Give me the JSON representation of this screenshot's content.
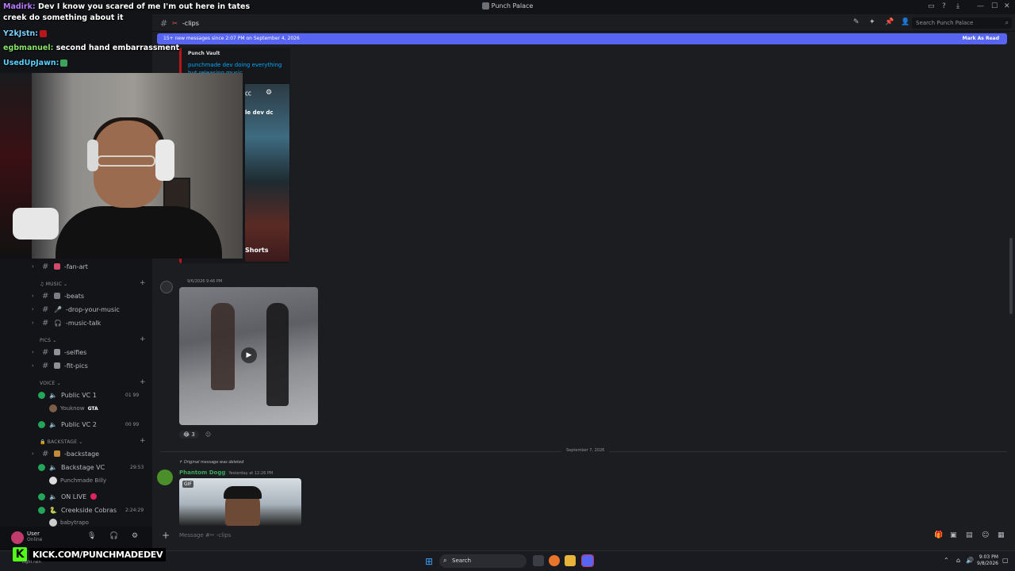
{
  "window": {
    "title": "Punch Palace",
    "controls": [
      "—",
      "☐",
      "✕"
    ]
  },
  "stream_chat": [
    {
      "user": "Madirk:",
      "text": "Dev I know you scared of me I'm out here in tates"
    },
    {
      "user": "",
      "text": "creek do something about it"
    },
    {
      "user": "Y2kJstn:",
      "text": ""
    },
    {
      "user": "egbmanuel:",
      "text": "second hand embarrassment"
    },
    {
      "user": "UsedUpJawn:",
      "text": ""
    }
  ],
  "kick": {
    "logo": "K",
    "url": "KICK.COM/PUNCHMADEDEV"
  },
  "sidebar": {
    "server_name": "Punch Palace",
    "channels": [
      {
        "name": "-fan-art"
      },
      {
        "category": "MUSIC"
      },
      {
        "name": "-beats"
      },
      {
        "name": "-drop-your-music"
      },
      {
        "name": "-music-talk"
      },
      {
        "category": "PICS"
      },
      {
        "name": "-selfies"
      },
      {
        "name": "-fit-pics"
      },
      {
        "category": "VOICE"
      },
      {
        "voice": "Public VC 1",
        "count": "01 99"
      },
      {
        "user": "Youknow",
        "activity": "GTA"
      },
      {
        "voice": "Public VC 2",
        "count": "00 99"
      },
      {
        "category": "BACKSTAGE"
      },
      {
        "name": "-backstage"
      },
      {
        "voice": "Backstage VC",
        "count": "29:53"
      },
      {
        "user": "Punchmade Billy"
      },
      {
        "voice": "ON LIVE"
      },
      {
        "voice": "Creekside Cobras",
        "count": "2:24:29"
      },
      {
        "user": "babytrapo"
      }
    ],
    "user_panel": {
      "name": "User",
      "status": "Online",
      "sub": "Light rain"
    }
  },
  "header": {
    "channel": "-clips",
    "search_placeholder": "Search Punch Palace"
  },
  "new_messages": {
    "text": "15+ new messages since 2:07 PM on September 4, 2026",
    "action": "Mark As Read"
  },
  "messages": {
    "embed_provider": "Punch Vault",
    "embed_title": "punchmade dev doing everything",
    "embed_title2": "but releasing music",
    "shorts_caption": "le dev dc",
    "shorts_label": "Shorts",
    "msg2_author": "",
    "msg2_time": "9/6/2026 9:46 PM",
    "reaction_count": "3",
    "date_divider": "September 7, 2026",
    "reply_text": "Original message was deleted",
    "msg3_author": "Phantom Dogg",
    "msg3_time": "Yesterday at 12:26 PM",
    "gif_tag": "GIF"
  },
  "composer": {
    "placeholder": "Message #✂ -clips"
  },
  "taskbar": {
    "search": "Search",
    "time": "9:03 PM",
    "date": "9/8/2026"
  },
  "colors": {
    "accent": "#5865f2",
    "online": "#23a55a",
    "kick": "#53fc18",
    "embed_bar": "#b8161d"
  }
}
